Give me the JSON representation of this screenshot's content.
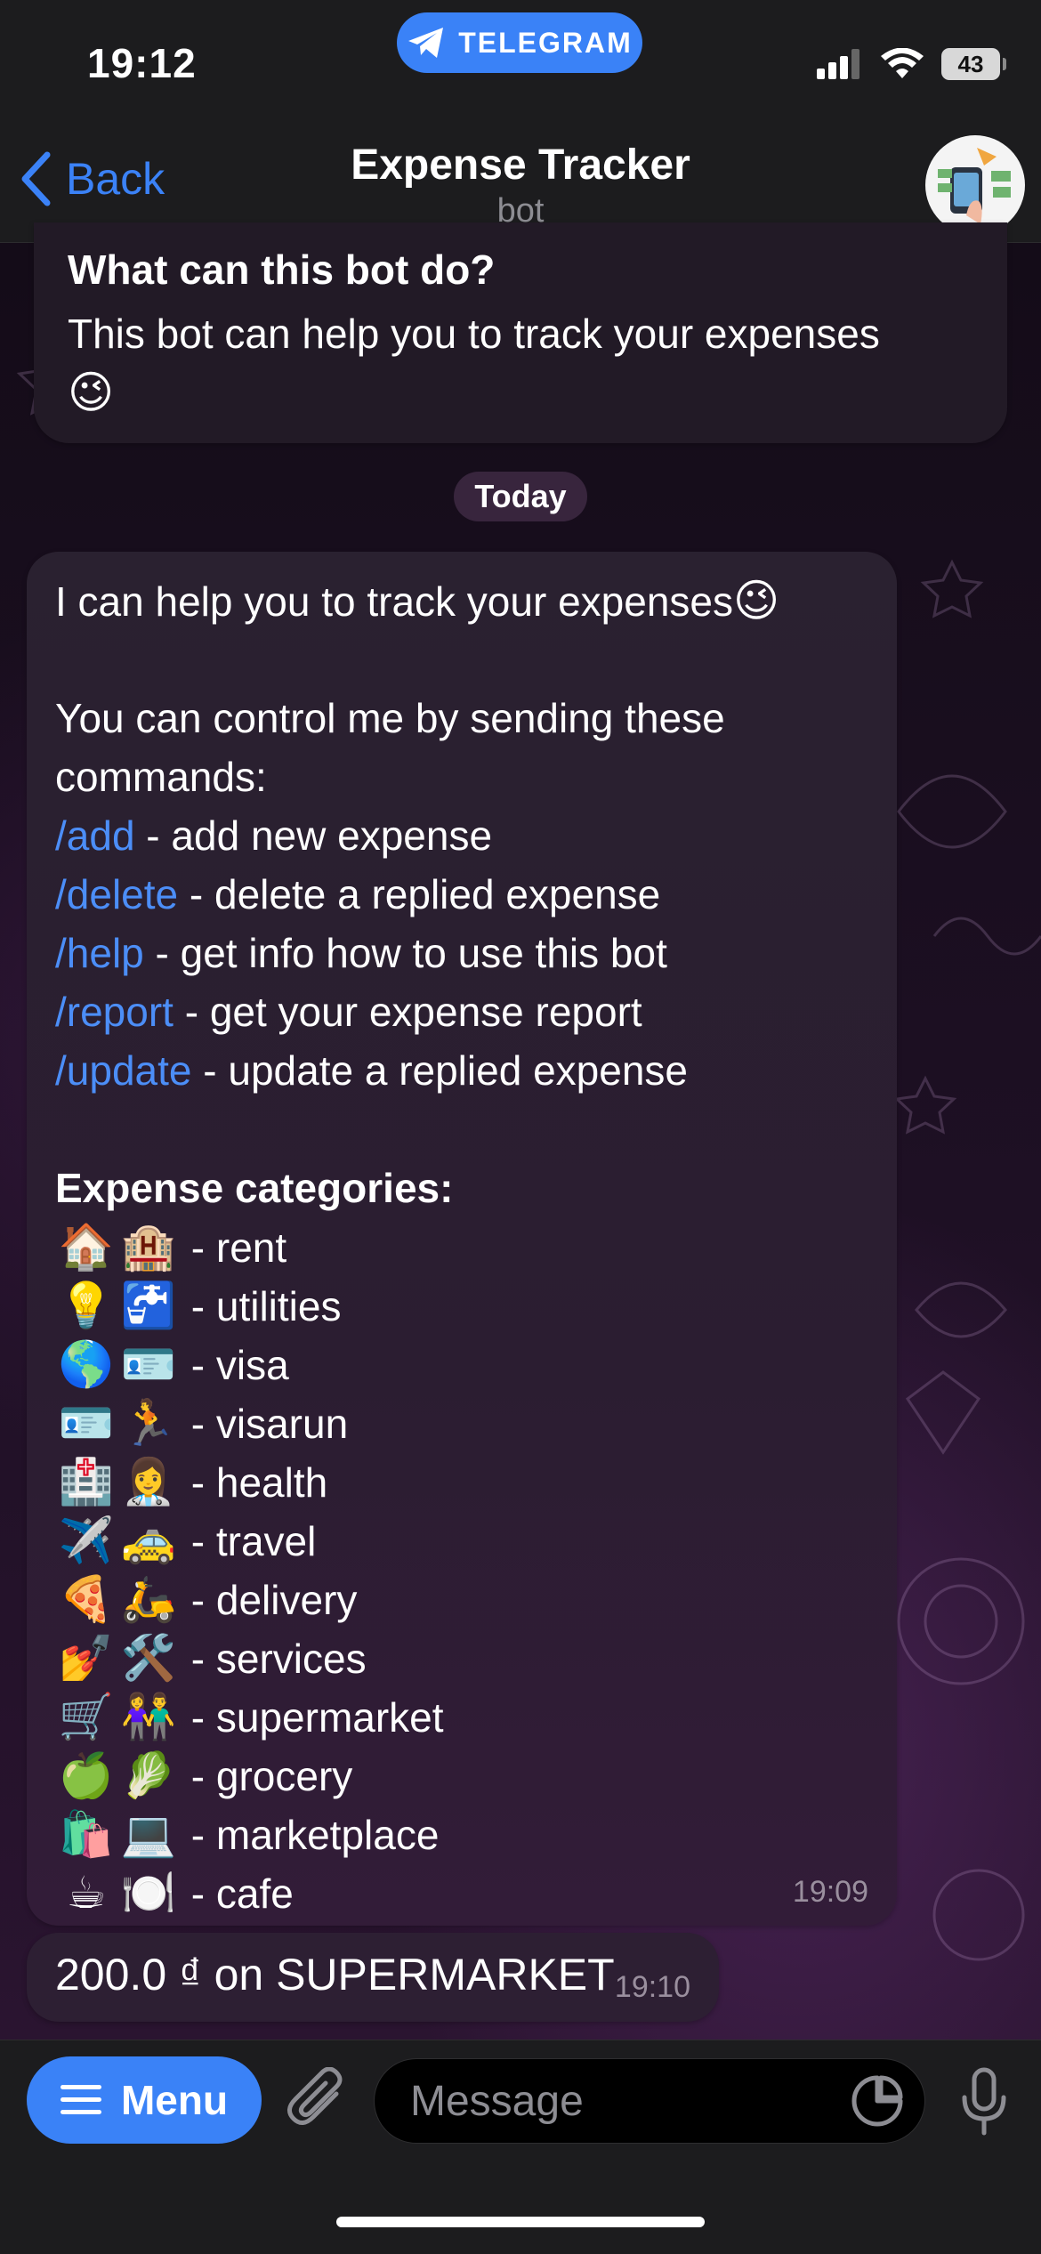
{
  "status_bar": {
    "time": "19:12",
    "app_pill": "TELEGRAM",
    "battery": "43"
  },
  "nav": {
    "back_label": "Back",
    "title": "Expense Tracker",
    "subtitle": "bot"
  },
  "intro": {
    "title": "What can this bot do?",
    "text": "This bot can help you to track your expenses",
    "emoji": "😉"
  },
  "date_separator": "Today",
  "message": {
    "intro_line": "I can help you to track your expenses",
    "intro_emoji": "😉",
    "control_text_1": "You can control me by sending these",
    "control_text_2": "commands:",
    "commands": [
      {
        "command": "/add",
        "description": " - add new expense"
      },
      {
        "command": "/delete",
        "description": " - delete a replied expense"
      },
      {
        "command": "/help",
        "description": " - get info how to use this bot"
      },
      {
        "command": "/report",
        "description": " - get your expense report"
      },
      {
        "command": "/update",
        "description": " - update a replied expense"
      }
    ],
    "categories_title": "Expense categories:",
    "categories": [
      {
        "emoji1": "🏠",
        "emoji2": "🏨",
        "label": " - rent"
      },
      {
        "emoji1": "💡",
        "emoji2": "🚰",
        "label": " - utilities"
      },
      {
        "emoji1": "🌎",
        "emoji2": "🪪",
        "label": " - visa"
      },
      {
        "emoji1": "🪪",
        "emoji2": "🏃",
        "label": " - visarun"
      },
      {
        "emoji1": "🏥",
        "emoji2": "👩‍⚕️",
        "label": " - health"
      },
      {
        "emoji1": "✈️",
        "emoji2": "🚕",
        "label": " - travel"
      },
      {
        "emoji1": "🍕",
        "emoji2": "🛵",
        "label": " - delivery"
      },
      {
        "emoji1": "💅",
        "emoji2": "🛠️",
        "label": " - services"
      },
      {
        "emoji1": "🛒",
        "emoji2": "👫",
        "label": " - supermarket"
      },
      {
        "emoji1": "🍏",
        "emoji2": "🥬",
        "label": " - grocery"
      },
      {
        "emoji1": "🛍️",
        "emoji2": "💻",
        "label": " - marketplace"
      },
      {
        "emoji1": "☕",
        "emoji2": "🍽️",
        "label": " - cafe"
      }
    ],
    "time": "19:09"
  },
  "reply": {
    "text": "200.0 ₫ on SUPERMARKET",
    "time": "19:10"
  },
  "input_bar": {
    "menu_label": "Menu",
    "placeholder": "Message"
  },
  "colors": {
    "accent": "#3a82f7",
    "command_link": "#4c8ef7",
    "bubble": "#2a2130"
  }
}
